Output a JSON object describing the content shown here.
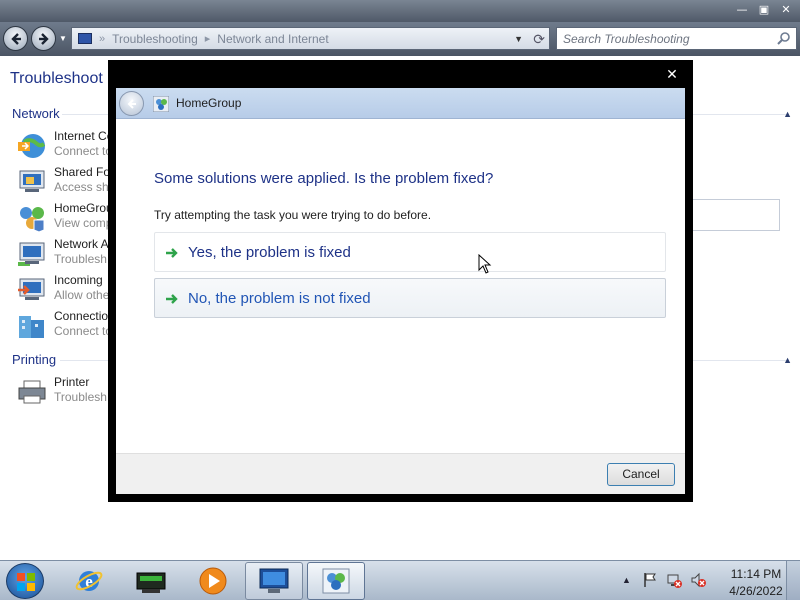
{
  "explorer": {
    "breadcrumb": [
      "Troubleshooting",
      "Network and Internet"
    ],
    "search_placeholder": "Search Troubleshooting",
    "heading": "Troubleshoot p",
    "groups": [
      {
        "title": "Network",
        "items": [
          {
            "title": "Internet Co",
            "subtitle": "Connect to",
            "icon": "internet-connections-icon"
          },
          {
            "title": "Shared Fol",
            "subtitle": "Access sha",
            "icon": "shared-folders-icon"
          },
          {
            "title": "HomeGrou",
            "subtitle": "View comp",
            "icon": "homegroup-icon"
          },
          {
            "title": "Network A",
            "subtitle": "Troublesh",
            "icon": "network-adapter-icon"
          },
          {
            "title": "Incoming",
            "subtitle": "Allow othe",
            "icon": "incoming-connections-icon"
          },
          {
            "title": "Connection",
            "subtitle": "Connect to",
            "icon": "connection-workplace-icon"
          }
        ]
      },
      {
        "title": "Printing",
        "items": [
          {
            "title": "Printer",
            "subtitle": "Troublesh",
            "icon": "printer-icon"
          }
        ]
      }
    ]
  },
  "dialog": {
    "title": "HomeGroup",
    "question": "Some solutions were applied. Is the problem fixed?",
    "hint": "Try attempting the task you were trying to do before.",
    "options": [
      {
        "label": "Yes, the problem is fixed"
      },
      {
        "label": "No, the problem is not fixed"
      }
    ],
    "cancel_label": "Cancel"
  },
  "taskbar": {
    "pinned": [
      "internet-explorer-icon",
      "network-printer-icon",
      "media-player-icon",
      "remote-desktop-icon",
      "homegroup-troubleshooter-icon"
    ],
    "time": "11:14 PM",
    "date": "4/26/2022"
  }
}
